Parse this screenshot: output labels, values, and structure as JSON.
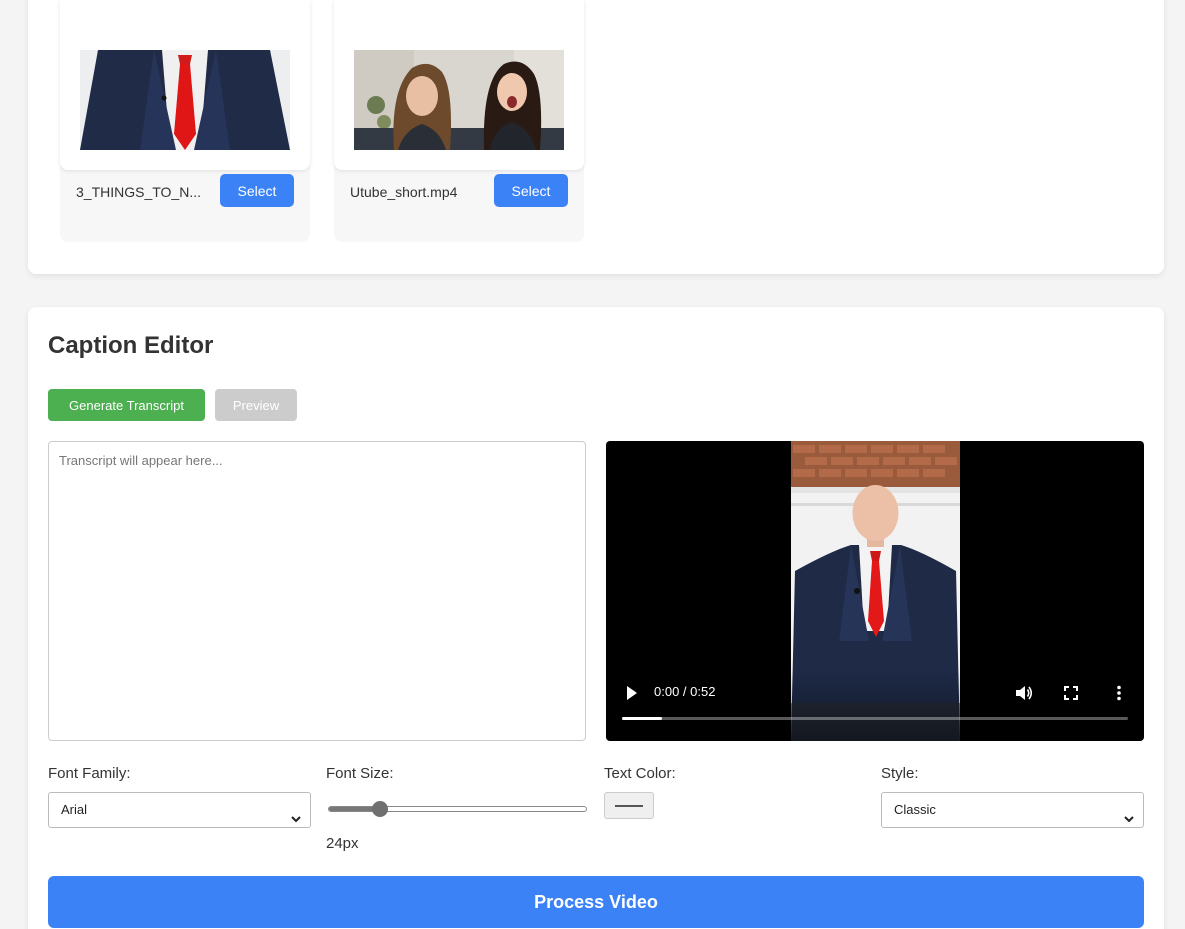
{
  "videos": [
    {
      "name": "3_THINGS_TO_N...",
      "select_label": "Select"
    },
    {
      "name": "Utube_short.mp4",
      "select_label": "Select"
    }
  ],
  "editor": {
    "title": "Caption Editor",
    "generate_label": "Generate Transcript",
    "preview_label": "Preview",
    "transcript_placeholder": "Transcript will appear here...",
    "player": {
      "time": "0:00 / 0:52",
      "progress": 0.08
    },
    "font_family": {
      "label": "Font Family:",
      "value": "Arial"
    },
    "font_size": {
      "label": "Font Size:",
      "value_text": "24px",
      "value": 24,
      "min": 12,
      "max": 72
    },
    "text_color": {
      "label": "Text Color:",
      "value": "#555555"
    },
    "style": {
      "label": "Style:",
      "value": "Classic"
    },
    "process_label": "Process Video"
  },
  "colors": {
    "primary": "#3b82f6",
    "success": "#4caf50",
    "disabled": "#cccccc"
  }
}
